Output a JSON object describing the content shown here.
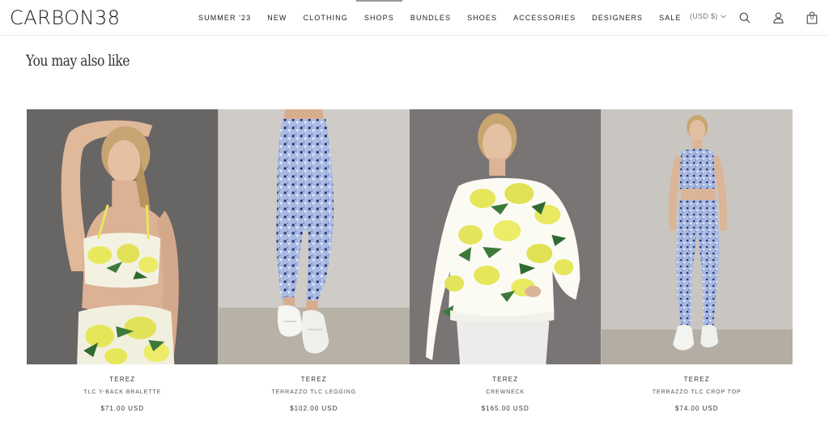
{
  "brand_logo": "CARBON38",
  "nav": {
    "items": [
      {
        "label": "SUMMER '23"
      },
      {
        "label": "NEW"
      },
      {
        "label": "CLOTHING"
      },
      {
        "label": "SHOPS"
      },
      {
        "label": "BUNDLES"
      },
      {
        "label": "SHOES"
      },
      {
        "label": "ACCESSORIES"
      },
      {
        "label": "DESIGNERS"
      },
      {
        "label": "SALE"
      }
    ]
  },
  "utility": {
    "currency": "(USD $)",
    "cart_count": "0",
    "icons": [
      "search-icon",
      "account-icon",
      "cart-icon",
      "chevron-down-icon"
    ]
  },
  "section": {
    "title": "You may also like"
  },
  "products": [
    {
      "brand": "TEREZ",
      "name": "TLC Y-BACK BRALETTE",
      "price": "$71.00 USD"
    },
    {
      "brand": "TEREZ",
      "name": "TERRAZZO TLC LEGGING",
      "price": "$102.00 USD"
    },
    {
      "brand": "TEREZ",
      "name": "CREWNECK",
      "price": "$165.00 USD"
    },
    {
      "brand": "TEREZ",
      "name": "TERRAZZO TLC CROP TOP",
      "price": "$74.00 USD"
    }
  ],
  "colors": {
    "text": "#222222",
    "muted": "#777777",
    "lemon_yellow": "#e6e65a",
    "leaf_green": "#3d7a3a",
    "terrazzo_blue": "#8fa6d8",
    "backdrop_dark": "#6e6b6a",
    "backdrop_light": "#c9c6c1"
  }
}
